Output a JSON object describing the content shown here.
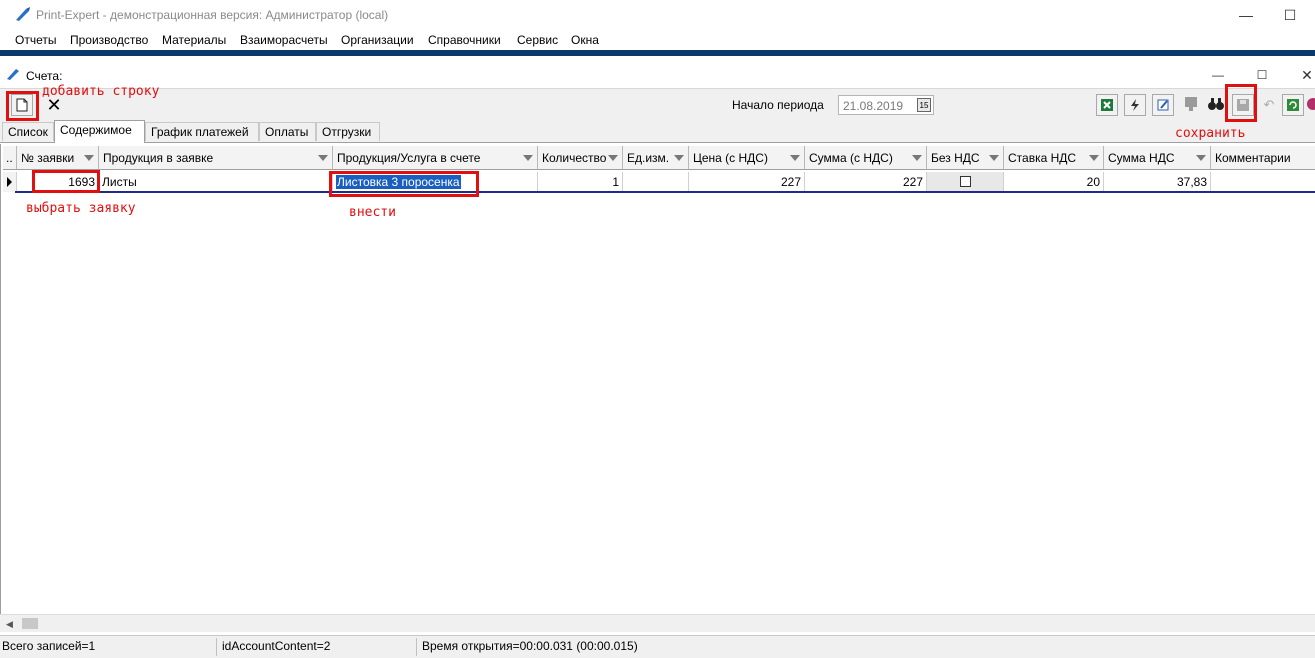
{
  "app": {
    "title": "Print-Expert - демонстрационная версия: Администратор (local)"
  },
  "menu": [
    "Отчеты",
    "Производство",
    "Материалы",
    "Взаиморасчеты",
    "Организации",
    "Справочники",
    "Сервис",
    "Окна"
  ],
  "child_window": {
    "title": "Счета:"
  },
  "toolbar": {
    "period_label": "Начало периода",
    "period_value": "21.08.2019",
    "calendar_glyph": "15"
  },
  "tabs": [
    "Список",
    "Содержимое",
    "График платежей",
    "Оплаты",
    "Отгрузки"
  ],
  "active_tab": "Содержимое",
  "grid": {
    "columns": [
      "№ заявки",
      "Продукция в заявке",
      "Продукция/Услуга в счете",
      "Количество",
      "Ед.изм.",
      "Цена (с НДС)",
      "Сумма (с НДС)",
      "Без НДС",
      "Ставка НДС",
      "Сумма НДС",
      "Комментарии"
    ],
    "rows": [
      {
        "order_no": "1693",
        "product_in_order": "Листы",
        "product_in_invoice": "Листовка 3 поросенка",
        "quantity": "1",
        "unit": "",
        "price": "227",
        "sum": "227",
        "no_vat": false,
        "vat_rate": "20",
        "vat_sum": "37,83",
        "comment": ""
      }
    ]
  },
  "status": {
    "records": "Всего записей=1",
    "id": "idAccountContent=2",
    "open_time": "Время открытия=00:00.031 (00:00.015)"
  },
  "annotations": {
    "add_row": "добавить строку",
    "select_order": "выбрать заявку",
    "enter": "внести",
    "save": "сохранить",
    "annotation_color": "#e01010"
  }
}
